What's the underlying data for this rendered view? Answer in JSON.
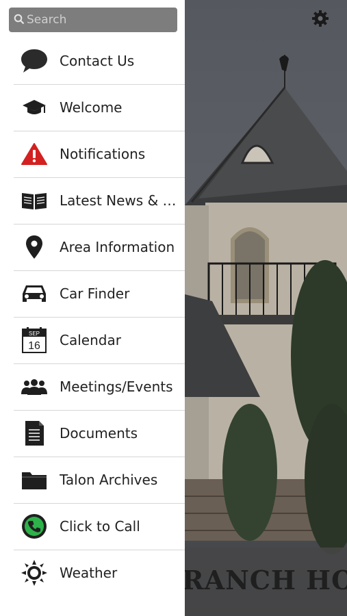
{
  "search": {
    "placeholder": "Search"
  },
  "menu": [
    {
      "label": "Contact Us",
      "icon": "speech-bubble-icon"
    },
    {
      "label": "Welcome",
      "icon": "graduation-cap-icon"
    },
    {
      "label": "Notifications",
      "icon": "warning-icon"
    },
    {
      "label": "Latest News & Events",
      "icon": "open-book-icon"
    },
    {
      "label": "Area Information",
      "icon": "map-pin-icon"
    },
    {
      "label": "Car Finder",
      "icon": "car-icon"
    },
    {
      "label": "Calendar",
      "icon": "calendar-icon",
      "calendar_month": "SEP",
      "calendar_day": "16"
    },
    {
      "label": "Meetings/Events",
      "icon": "people-icon"
    },
    {
      "label": "Documents",
      "icon": "document-icon"
    },
    {
      "label": "Talon Archives",
      "icon": "folder-icon"
    },
    {
      "label": "Click to Call",
      "icon": "phone-icon"
    },
    {
      "label": "Weather",
      "icon": "sun-icon"
    }
  ],
  "background": {
    "banner_text": "RANCH HOA"
  },
  "colors": {
    "alert_red": "#d32121",
    "call_green": "#2db24a",
    "drawer_bg": "#ffffff",
    "search_bg": "#7d7d7d"
  }
}
